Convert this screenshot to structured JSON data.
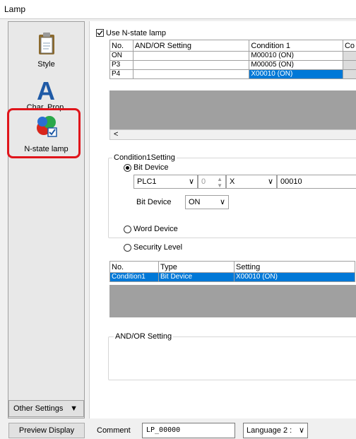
{
  "window": {
    "title": "Lamp"
  },
  "sidebar": {
    "items": [
      {
        "label": "Style"
      },
      {
        "label": "Char. Prop."
      },
      {
        "label": "N-state lamp"
      }
    ],
    "other_settings": "Other Settings"
  },
  "nstate": {
    "use_label": "Use N-state lamp",
    "columns": [
      "No.",
      "AND/OR Setting",
      "Condition 1",
      "Co"
    ],
    "rows": [
      {
        "no": "ON",
        "andor": "",
        "cond1": "M00010 (ON)"
      },
      {
        "no": "P3",
        "andor": "",
        "cond1": "M00005 (ON)"
      },
      {
        "no": "P4",
        "andor": "",
        "cond1": "X00010 (ON)"
      }
    ],
    "scroll_left": "<"
  },
  "condition": {
    "group_title": "Condition1Setting",
    "bit_device_label": "Bit Device",
    "plc": "PLC1",
    "station": "0",
    "device_type": "X",
    "address": "00010",
    "bit_device_field_label": "Bit Device",
    "bit_state": "ON",
    "word_device_label": "Word Device",
    "security_level_label": "Security Level"
  },
  "cond_table": {
    "columns": [
      "No.",
      "Type",
      "Setting"
    ],
    "rows": [
      {
        "no": "Condition1",
        "type": "Bit Device",
        "setting": "X00010 (ON)"
      }
    ]
  },
  "andor_group": {
    "title": "AND/OR Setting"
  },
  "footer": {
    "preview_button": "Preview Display",
    "comment_label": "Comment",
    "comment_value": "LP_00000",
    "language_value": "Language 2 :"
  }
}
